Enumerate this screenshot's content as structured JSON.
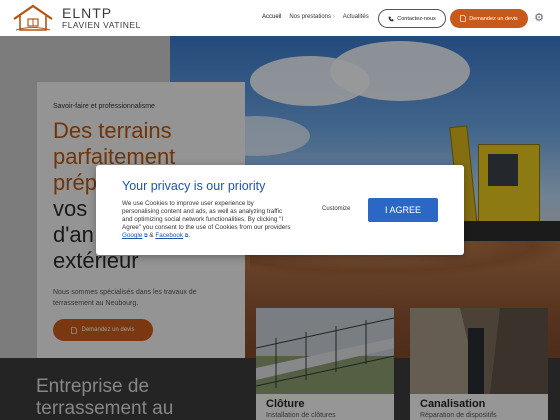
{
  "header": {
    "brand_name": "ELNTP",
    "brand_sub": "FLAVIEN VATINEL",
    "nav": [
      {
        "label": "Accueil"
      },
      {
        "label": "Nos prestations"
      },
      {
        "label": "Actualités"
      }
    ],
    "nav_chevron": "›",
    "contact_label": "Contactez-nous",
    "devis_label": "Demandez un devis"
  },
  "hero": {
    "eyebrow": "Savoir-faire et professionnalisme",
    "title_line1": "Des terrains",
    "title_line2": "parfaitement",
    "title_line3": "prép",
    "title_line4": "vos",
    "title_line5": "d'an",
    "title_line6": "extérieur",
    "description": "Nous sommes spécialisés dans les travaux de terrassement au Neubourg.",
    "cta_label": "Demandez un devis"
  },
  "bottom": {
    "title": "Entreprise de terrassement au"
  },
  "services": [
    {
      "title": "Clôture",
      "subtitle": "Installation de clôtures"
    },
    {
      "title": "Canalisation",
      "subtitle": "Réparation de dispositifs"
    }
  ],
  "cookie_modal": {
    "title": "Your privacy is our priority",
    "text_before": "We use Cookies to improve user experience by personalising content and ads, as well as analyzing traffic and optimizing social network functionalities. By clicking \"I Agree\" you consent to the use of Cookies from our providers ",
    "google_link": "Google",
    "and_text": " & ",
    "facebook_link": "Facebook",
    "text_after": ".",
    "customize_label": "Customize",
    "agree_label": "I AGREE"
  },
  "colors": {
    "accent": "#c75a1a",
    "title_orange": "#b45411",
    "modal_blue": "#2053a8",
    "agree_blue": "#2b68c6"
  },
  "icons": {
    "logo": "house-roof-logo",
    "phone": "phone-icon",
    "devis": "document-icon",
    "settings": "gear-icon",
    "external": "external-link-icon"
  }
}
